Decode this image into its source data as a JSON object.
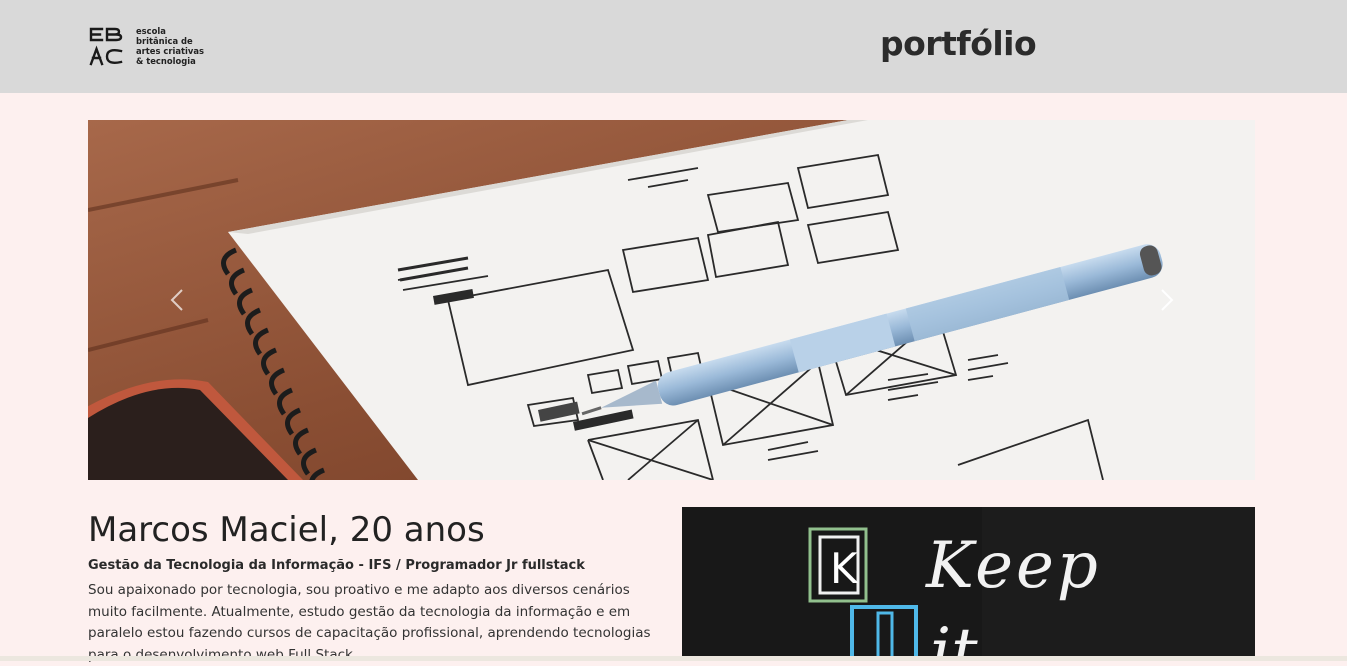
{
  "header": {
    "logo": {
      "mark": "EBAC",
      "lines": [
        "escola",
        "britânica de",
        "artes criativas",
        "& tecnologia"
      ]
    },
    "title": "portfólio"
  },
  "carousel": {
    "slide_image": "notebook-wireframe-sketch-with-pen",
    "prev_icon": "chevron-left-icon",
    "next_icon": "chevron-right-icon"
  },
  "profile": {
    "name": "Marcos Maciel, 20 anos",
    "role": "Gestão da Tecnologia da Informação - IFS / Programador Jr fullstack",
    "bio": "Sou apaixonado por tecnologia, sou proativo e me adapto aos diversos cenários muito facilmente. Atualmente, estudo gestão da tecnologia da informação e em paralelo estou fazendo cursos de capacitação profissional, aprendendo tecnologias para o desenvolvimento web Full Stack."
  },
  "photo": {
    "image": "chalkboard-keep-it-simple",
    "text": {
      "letter_k": "K",
      "word_keep": "Keep",
      "letter_i": "I",
      "word_it": "it"
    }
  },
  "colors": {
    "header_bg": "#d9d9d9",
    "page_bg": "#fdf0ef",
    "text_dark": "#222222"
  }
}
